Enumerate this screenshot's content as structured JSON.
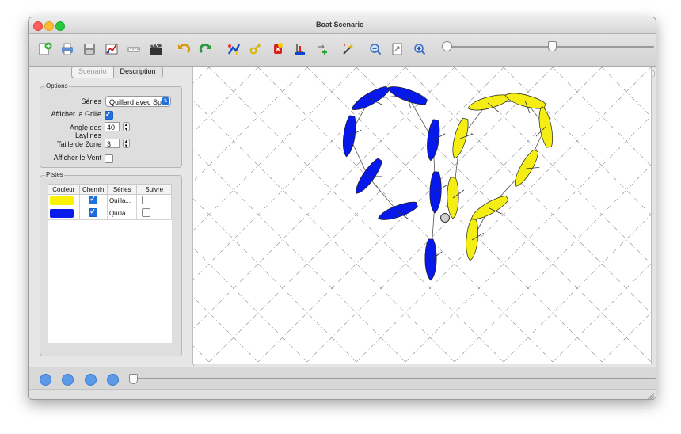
{
  "window": {
    "title": "Boat Scenario -"
  },
  "toolbar": {
    "icons": [
      "new-file-icon",
      "print-icon",
      "save-icon",
      "chart-icon",
      "ruler-icon",
      "clapper-icon",
      "undo-icon",
      "redo-icon",
      "add-track-icon",
      "key-icon",
      "delete-boat-icon",
      "bucket-icon",
      "add-waypoint-icon",
      "magic-wand-icon",
      "zoom-out-icon",
      "fit-page-icon",
      "zoom-in-icon"
    ],
    "zoom_slider": "zoom-slider"
  },
  "left": {
    "tabs": [
      "Scénario",
      "Description"
    ],
    "options": {
      "title": "Options",
      "series_label": "Séries",
      "series_value": "Quillard avec Spi",
      "grid_label": "Afficher la Grille",
      "grid_checked": true,
      "laylines_label": "Angle des Laylines",
      "laylines_value": "40",
      "zone_label": "Taille de Zone",
      "zone_value": "3",
      "wind_label": "Afficher le Vent",
      "wind_checked": false
    },
    "pistes": {
      "title": "Pistes",
      "headers": [
        "Couleur",
        "Chemin",
        "Séries",
        "Suivre"
      ],
      "rows": [
        {
          "color": "#fbf200",
          "chemin": true,
          "series": "Quilla...",
          "suivre": false
        },
        {
          "color": "#0a1aea",
          "chemin": true,
          "series": "Quilla...",
          "suivre": false
        }
      ]
    }
  },
  "canvas": {
    "colors": {
      "yellow": "#f5ee14",
      "blue": "#0719ea",
      "grid": "#8a8a8a"
    }
  },
  "bottom": {
    "buttons": [
      "play-icon",
      "pause-icon",
      "stop-icon",
      "loop-icon"
    ]
  }
}
